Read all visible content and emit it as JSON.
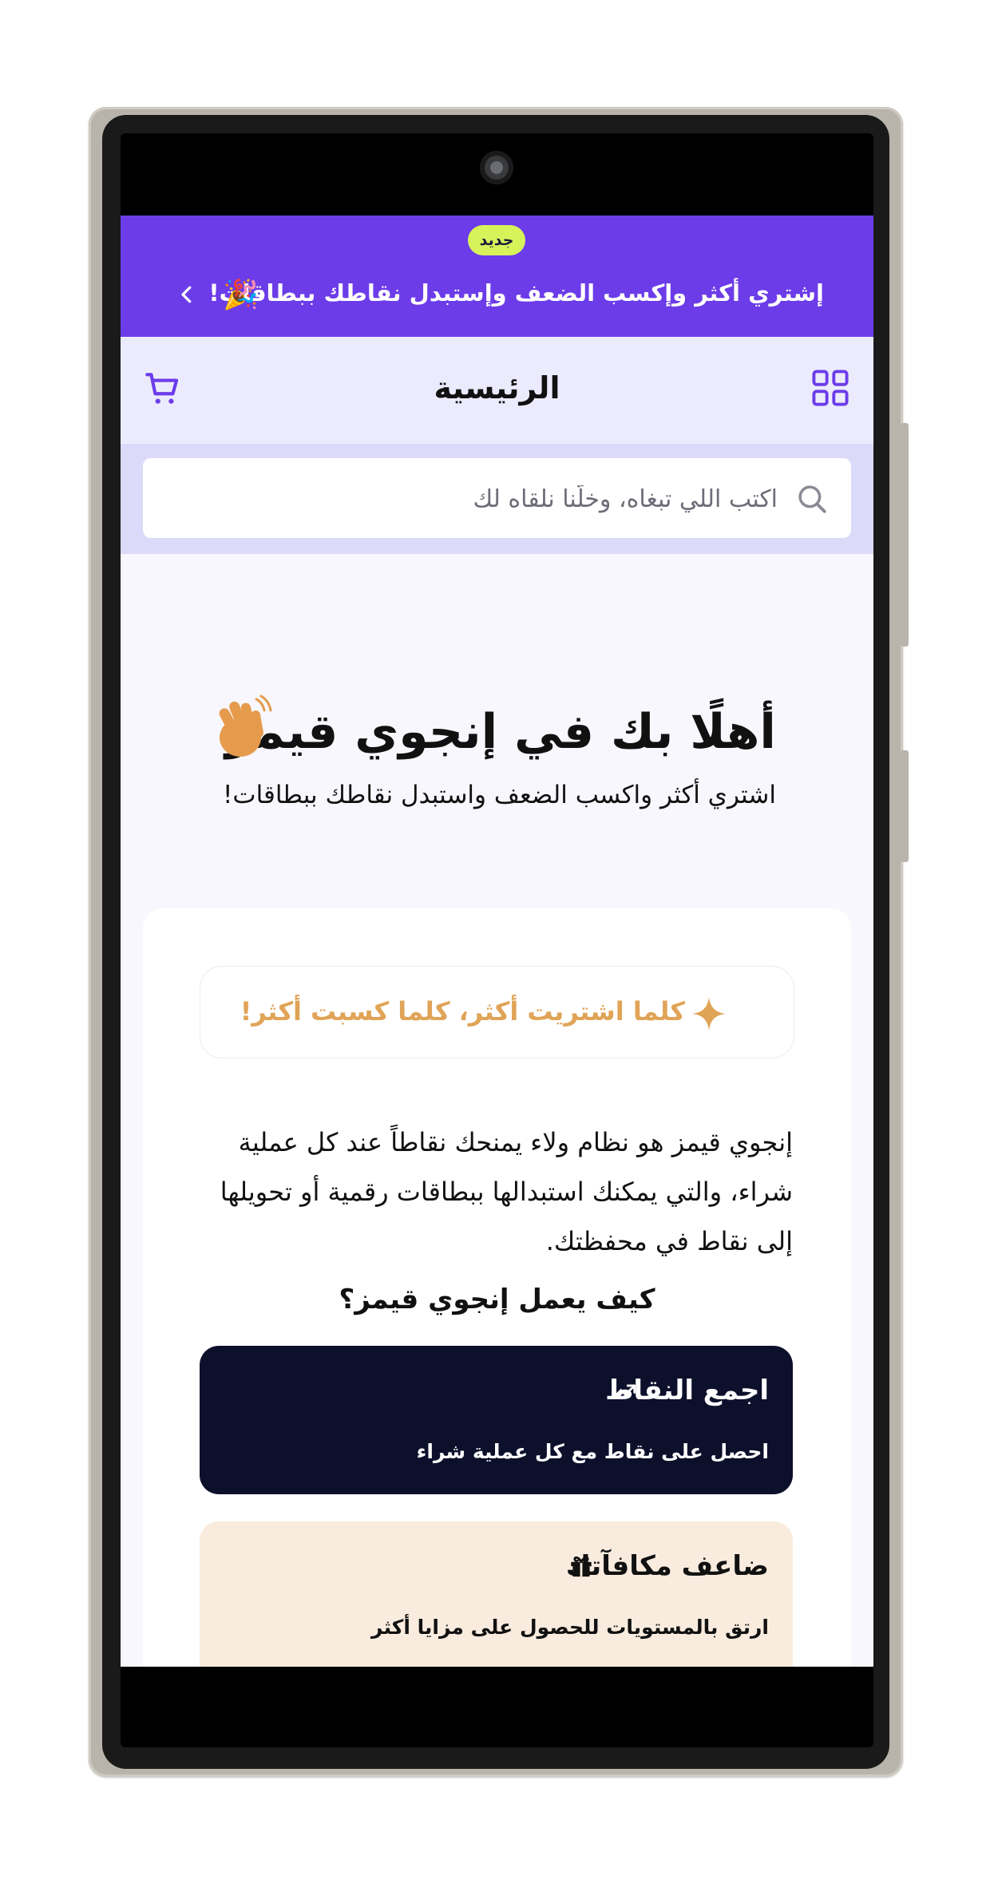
{
  "promo": {
    "badge": "جديد",
    "text": "إشتري أكثر وإكسب الضعف وإستبدل نقاطك ببطاقات!",
    "confetti": "🎉"
  },
  "header": {
    "title": "الرئيسية"
  },
  "search": {
    "placeholder": "اكتب اللي تبغاه، وخلّنا نلقاه لك"
  },
  "hero": {
    "title": "أهلًا بك في إنجوي قيمز",
    "subtitle": "اشتري أكثر واكسب الضعف واستبدل نقاطك ببطاقات!"
  },
  "card": {
    "pill_text": "كلما اشتريت أكثر، كلما كسبت أكثر!",
    "description": "إنجوي قيمز هو نظام ولاء يمنحك نقاطاً عند كل عملية شراء، والتي يمكنك استبدالها ببطاقات رقمية أو تحويلها إلى نقاط في محفظتك.",
    "how_title": "كيف يعمل إنجوي قيمز؟",
    "steps": [
      {
        "title": "اجمع النقاط",
        "desc": "احصل على نقاط مع كل عملية شراء",
        "icon": "trending-up-icon"
      },
      {
        "title": "ضاعف مكافآتك",
        "desc": "ارتق بالمستويات للحصول على مزايا أكثر",
        "icon": "gift-icon"
      }
    ]
  },
  "colors": {
    "accent": "#6c3ce9",
    "badge": "#d8f35a",
    "highlight": "#e0a457",
    "dark_card": "#0c102b",
    "light_card": "#f9ecdf"
  }
}
